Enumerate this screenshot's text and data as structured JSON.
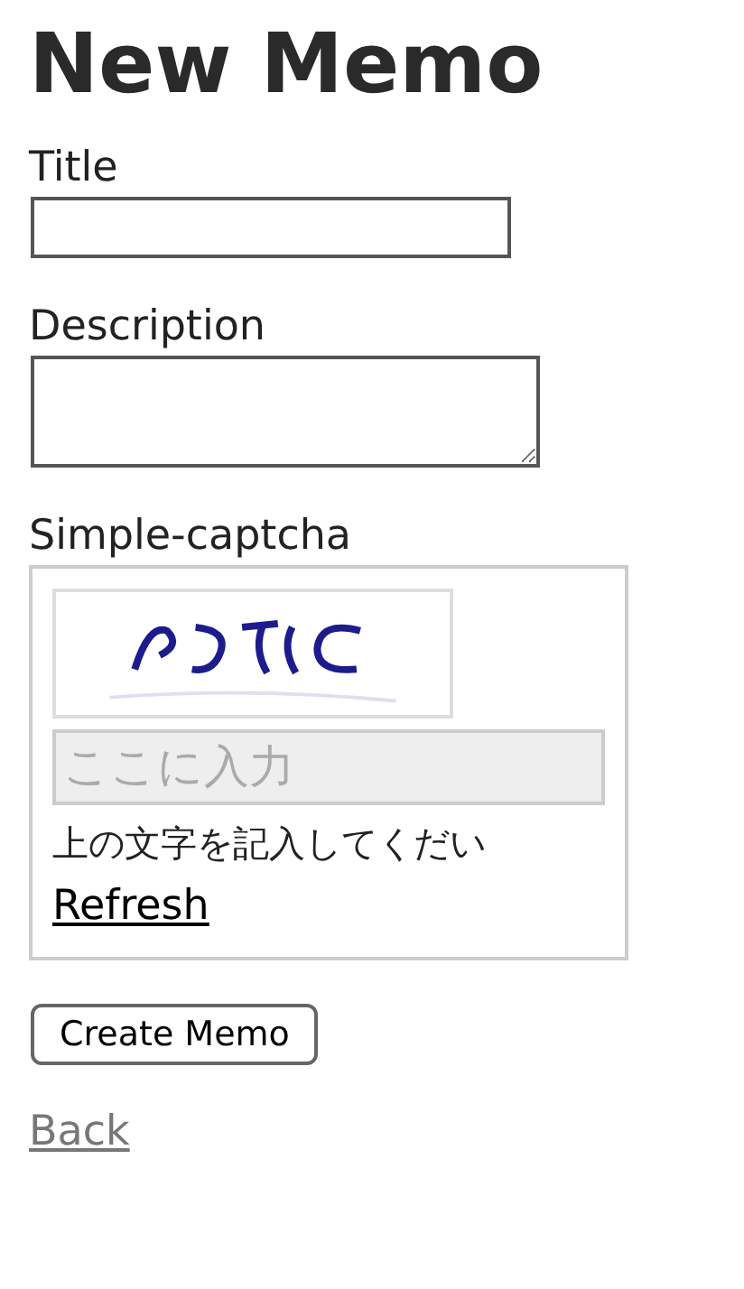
{
  "heading": "New Memo",
  "fields": [
    {
      "label": "Title",
      "kind": "text"
    },
    {
      "label": "Description",
      "kind": "textarea"
    }
  ],
  "captcha": {
    "label": "Simple-captcha",
    "placeholder": "ここに入力",
    "hint": "上の文字を記入してくだい",
    "refresh": "Refresh"
  },
  "submit": "Create Memo",
  "back": "Back"
}
